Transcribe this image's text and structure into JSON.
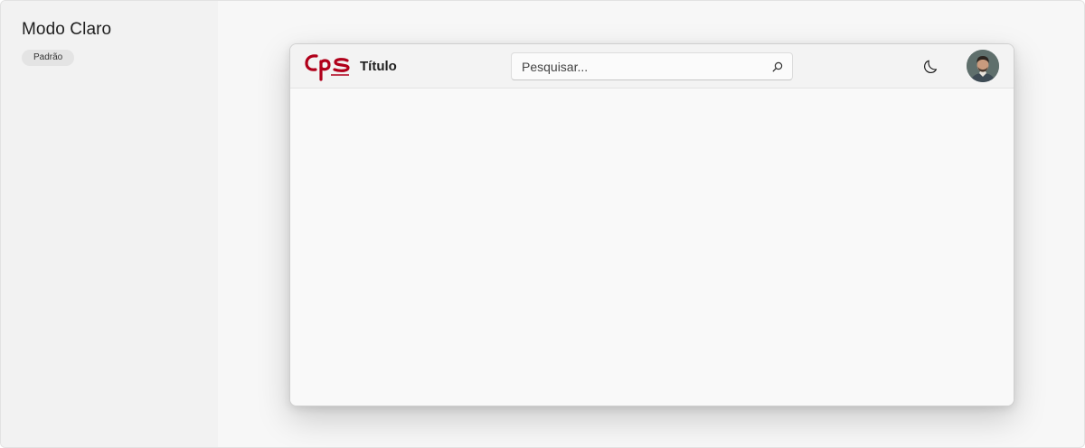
{
  "sidebar": {
    "title": "Modo Claro",
    "badge": "Padrão"
  },
  "window": {
    "logo_text": "CPS",
    "title": "Título",
    "search": {
      "placeholder": "Pesquisar...",
      "value": ""
    },
    "theme_toggle_icon": "moon-icon",
    "search_icon": "search-icon",
    "avatar": "user-avatar"
  },
  "colors": {
    "brand": "#b0001a",
    "sidebar_bg": "#f2f2f2",
    "canvas_bg": "#f7f7f7",
    "window_bg": "#f9f9f9",
    "titlebar_bg": "#f3f3f3"
  }
}
